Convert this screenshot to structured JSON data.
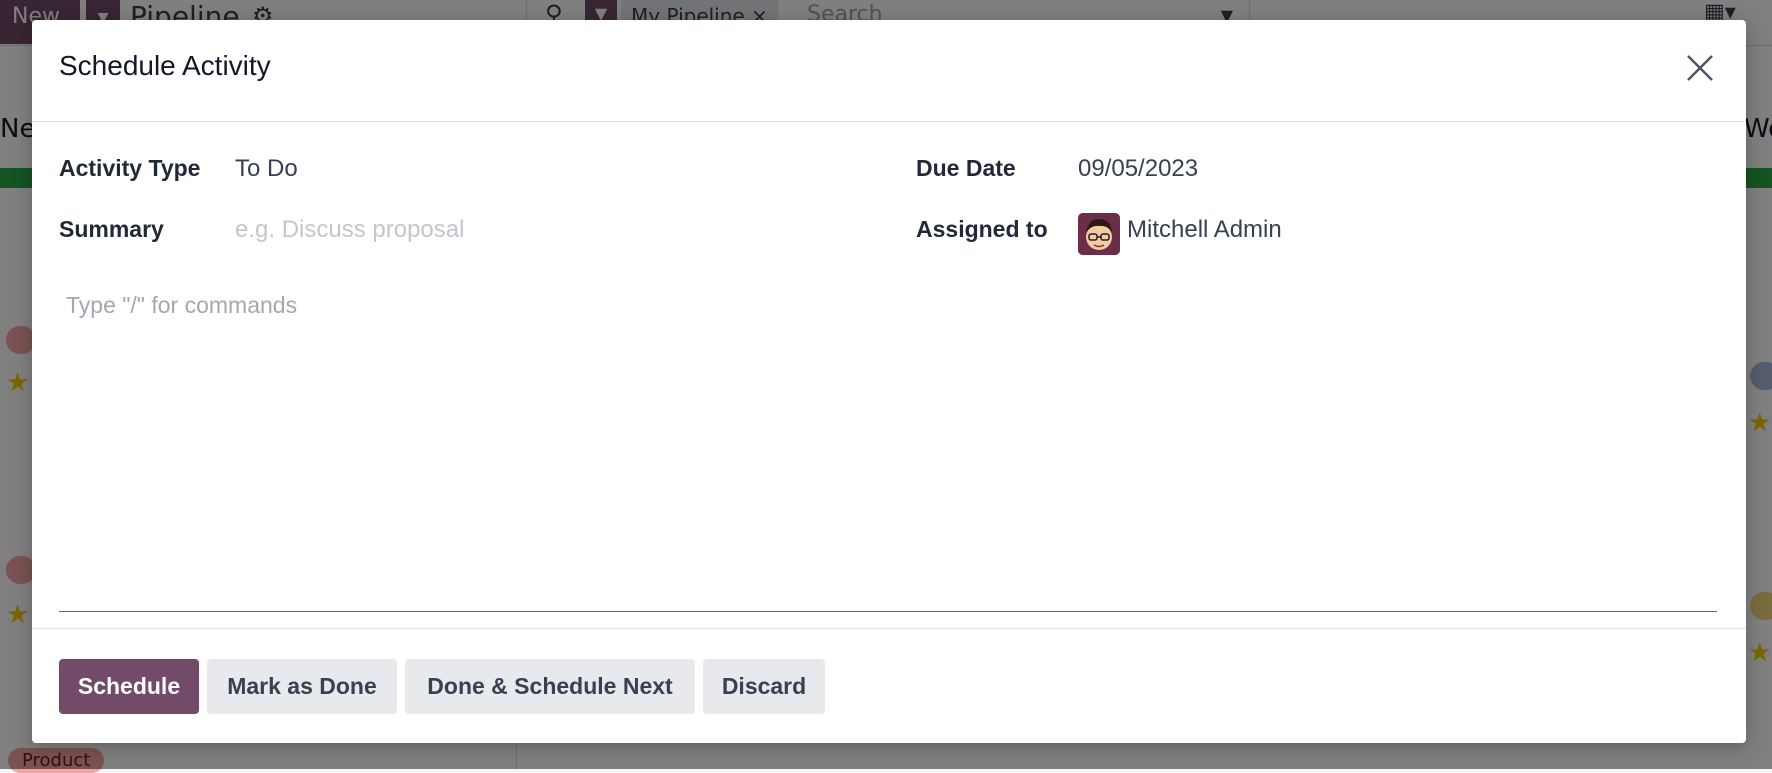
{
  "background": {
    "new_label": "New",
    "page_title": "Pipeline",
    "search_facet": "My Pipeline",
    "search_placeholder": "Search",
    "product_tag": "Product"
  },
  "dialog": {
    "title": "Schedule Activity",
    "fields": {
      "activity_type_label": "Activity Type",
      "activity_type_value": "To Do",
      "summary_label": "Summary",
      "summary_placeholder": "e.g. Discuss proposal",
      "due_date_label": "Due Date",
      "due_date_value": "09/05/2023",
      "assigned_to_label": "Assigned to",
      "assigned_to_value": "Mitchell Admin"
    },
    "editor_placeholder": "Type \"/\" for commands",
    "buttons": {
      "schedule": "Schedule",
      "mark_done": "Mark as Done",
      "done_schedule_next": "Done & Schedule Next",
      "discard": "Discard"
    }
  },
  "colors": {
    "primary": "#714B67",
    "secondary_button": "#e7e9ed",
    "editor_underline": "#3f7f8f",
    "stage_progress": "#28a745"
  },
  "icons": [
    "close-icon",
    "search-icon",
    "filter-icon",
    "gear-icon",
    "caret-down-icon",
    "kanban-view-icon",
    "avatar"
  ]
}
